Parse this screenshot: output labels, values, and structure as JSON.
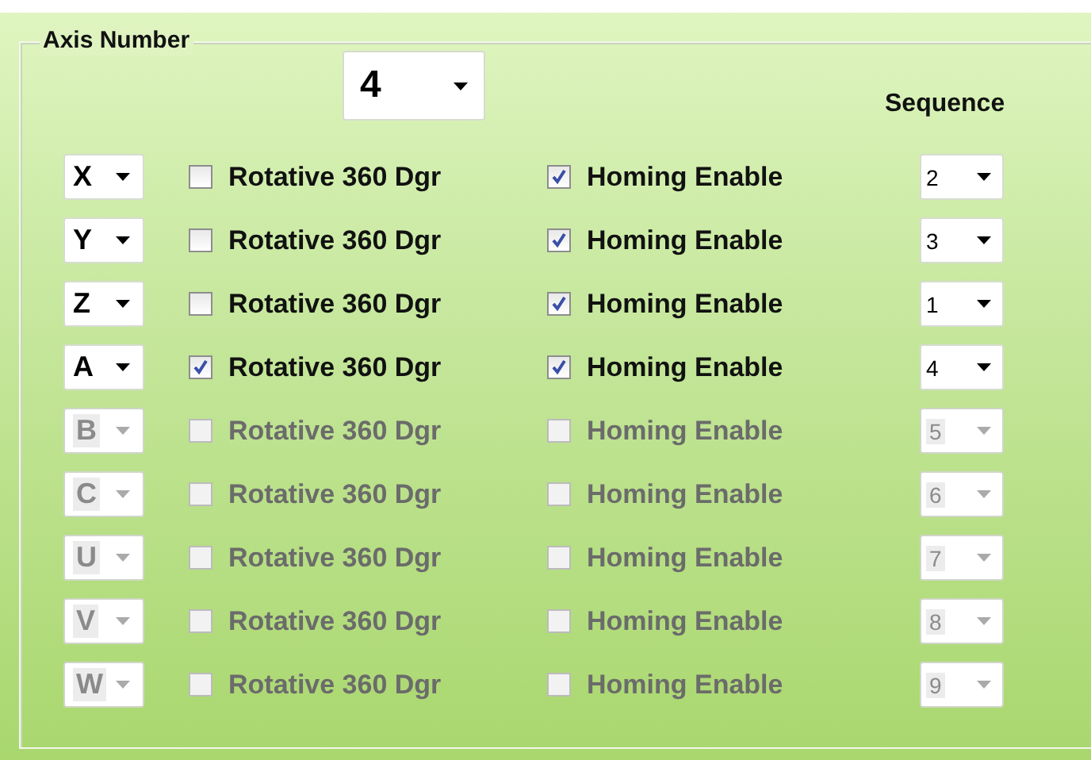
{
  "group": {
    "title": "Axis Number",
    "axis_number": {
      "value": "4"
    },
    "sequence_heading": "Sequence",
    "rows": [
      {
        "axis": "X",
        "rotative": {
          "label": "Rotative 360 Dgr",
          "checked": false
        },
        "homing": {
          "label": "Homing Enable",
          "checked": true
        },
        "sequence": "2",
        "disabled": false
      },
      {
        "axis": "Y",
        "rotative": {
          "label": "Rotative 360 Dgr",
          "checked": false
        },
        "homing": {
          "label": "Homing Enable",
          "checked": true
        },
        "sequence": "3",
        "disabled": false
      },
      {
        "axis": "Z",
        "rotative": {
          "label": "Rotative 360 Dgr",
          "checked": false
        },
        "homing": {
          "label": "Homing Enable",
          "checked": true
        },
        "sequence": "1",
        "disabled": false
      },
      {
        "axis": "A",
        "rotative": {
          "label": "Rotative 360 Dgr",
          "checked": true
        },
        "homing": {
          "label": "Homing Enable",
          "checked": true
        },
        "sequence": "4",
        "disabled": false
      },
      {
        "axis": "B",
        "rotative": {
          "label": "Rotative 360 Dgr",
          "checked": false
        },
        "homing": {
          "label": "Homing Enable",
          "checked": false
        },
        "sequence": "5",
        "disabled": true
      },
      {
        "axis": "C",
        "rotative": {
          "label": "Rotative 360 Dgr",
          "checked": false
        },
        "homing": {
          "label": "Homing Enable",
          "checked": false
        },
        "sequence": "6",
        "disabled": true
      },
      {
        "axis": "U",
        "rotative": {
          "label": "Rotative 360 Dgr",
          "checked": false
        },
        "homing": {
          "label": "Homing Enable",
          "checked": false
        },
        "sequence": "7",
        "disabled": true
      },
      {
        "axis": "V",
        "rotative": {
          "label": "Rotative 360 Dgr",
          "checked": false
        },
        "homing": {
          "label": "Homing Enable",
          "checked": false
        },
        "sequence": "8",
        "disabled": true
      },
      {
        "axis": "W",
        "rotative": {
          "label": "Rotative 360 Dgr",
          "checked": false
        },
        "homing": {
          "label": "Homing Enable",
          "checked": false
        },
        "sequence": "9",
        "disabled": true
      }
    ]
  }
}
